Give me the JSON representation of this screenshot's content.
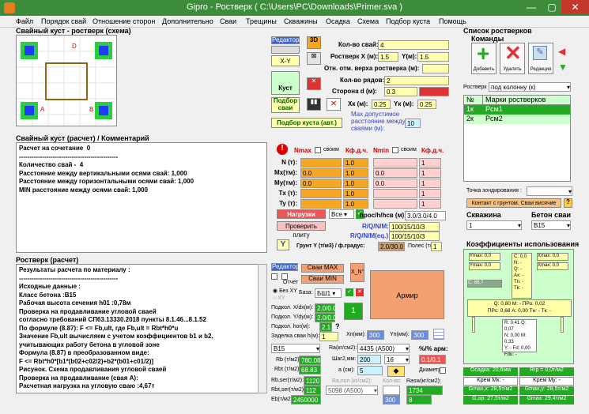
{
  "window": {
    "title": "Gipro - Ростверк ( C:\\Users\\PC\\Downloads\\Primer.sva )",
    "minimize": "—",
    "maximize": "▢",
    "close": "✕"
  },
  "menu": [
    "Файл",
    "Порядок свай",
    "Отношение сторон",
    "Дополнительно",
    "Сваи",
    "Трещины",
    "Скважины",
    "Осадка",
    "Схема",
    "Подбор куста",
    "Помощь"
  ],
  "scheme": {
    "title": "Свайный куст - ростверк (схема)",
    "pile_labels": [
      "D",
      "A",
      "B"
    ]
  },
  "tools": {
    "editor": "Редактор",
    "btn3d": "3D",
    "xy": "X-Y",
    "kust": "Куст",
    "podbor": "Подбор сваи",
    "podbor_auto": "Подбор куста (авт.)",
    "kol_svai_label": "Кол-во свай:",
    "kol_svai": "4",
    "rostverk_x_label": "Ростверк X (м):",
    "rostverk_x": "1.5",
    "ym_label": "Y(м):",
    "ym": "1.5",
    "otm_label": "Отн. отм. верха ростверка (м):",
    "otm": "",
    "kol_ryadov_label": "Кол-во рядов:",
    "kol_ryadov": "2",
    "storona_label": "Сторона d (м):",
    "storona": "0.3",
    "storona_extra": "",
    "xk_label": "Xк (м):",
    "xk": "0.25",
    "yk_label": "Yк (м):",
    "yk": "0.25",
    "max_dist_label": "Max допустимое расстояние между сваями (м):",
    "max_dist": "10"
  },
  "comment": {
    "title": "Свайный куст (расчет) / Комментарий",
    "lines": [
      "Расчет на сочетание  0",
      "-----------------------------------------------",
      "Количество свай -  4",
      "Расстояние между вертикальными осями свай: 1,000",
      "Расстояние между горизонтальными осями свай: 1,000",
      "MIN расстояние между осями свай: 1,000"
    ]
  },
  "loads": {
    "nmax": "Nmax",
    "svoim1": "своим",
    "kfdch1": "Кф.д.ч.",
    "nmin": "Nmin",
    "svoim2": "своим",
    "kfdch2": "Кф.д.ч.",
    "rows": [
      {
        "label": "N (т):",
        "v1": "",
        "k1": "1.0",
        "v2": "",
        "k2": "1"
      },
      {
        "label": "Mx(тм):",
        "v1": "0.0",
        "k1": "1.0",
        "v2": "0.0",
        "k2": "1"
      },
      {
        "label": "My(тм):",
        "v1": "0.0",
        "k1": "1.0",
        "v2": "0.0",
        "k2": "1"
      },
      {
        "label": "Tx (т):",
        "v1": "",
        "k1": "1.0",
        "v2": "",
        "k2": "1"
      },
      {
        "label": "Ty (т):",
        "v1": "",
        "k1": "1.0",
        "v2": "",
        "k2": "1"
      }
    ],
    "nagruzki": "Нагрузки",
    "vse": "Все",
    "proverit": "Проверить плиту",
    "hpoc_label": "hpoc/h/hcв (м):",
    "hpoc": "3.0/3.0/4.0",
    "rqnm_label": "R/Q/N/M:",
    "rqnm": "100/15/10/3",
    "rqnmeq_label": "R/Q/N/M(eq.):",
    "rqnmeq": "100/15/10/3",
    "ybtn": "Y",
    "grunt_label": "Грунт Y (т/м3) / ф.градус:",
    "grunt": "2.0/30.0",
    "poles_label": "Полес (т/м3):",
    "poles": "1"
  },
  "result": {
    "title": "Ростверк (расчет)",
    "lines": [
      "Результаты расчета по материалу :",
      "-----------------------------------------------",
      "Исходные данные :",
      "Класс бетона :В15",
      "Рабочая высота сечения h01 :0,78м",
      "Проверка на продавливание угловой сваей",
      "согласно требований СП63.13330.2018 пункты 8.1.46...8.1.52",
      "По формуле (8.87): F <= Fb,ult, где Fb,ult = Rbt*h0*u",
      "Значение Fb,ult вычисляем с учетом коэффициентов b1 и b2,",
      "учитывающих работу бетона в угловой зоне",
      "Формула (8.87) в преобразованном виде:",
      "F <= Rbt*h0*[b1*(b02+c02/2)+b2*(b01+c01/2)]",
      "",
      "Рисунок. Схема продавливания угловой сваей",
      "",
      "Проверка на продавливание (свая А):",
      "Расчетная нагрузка на угловую сваю :4,67т"
    ]
  },
  "armir": {
    "editor": "Редактор",
    "otchet": "Отчет",
    "svai_max": "Сваи MAX",
    "svai_min": "Сваи MIN",
    "xn": "X_N°",
    "bez_xy": "Без XY",
    "xy": "XY",
    "baza_label": "База:",
    "baza": "БШ1",
    "armir": "Армир",
    "one": "1",
    "podkol_x_label": "Подкол. X/dx(м):",
    "podkol_x": "2.0/0.0",
    "podkol_y_label": "Подкол. Y/dy(м):",
    "podkol_y": "2.0/0.0",
    "podkol_hor_label": "Подкол. hor(м):",
    "podkol_hor": "2.1",
    "zadelka_label": "Заделка сваи h(м):",
    "zadelka": "1",
    "xn_label": "Xn(мм):",
    "xn_val": "300",
    "yn_label": "Yn(мм):",
    "yn_val": "300",
    "beton": "B15",
    "rb_label": "Rb (т/м2):",
    "rb": "780.08",
    "rbt_label": "Rbt (т/м2):",
    "rbt": "68.83",
    "ra_label": "Ra(кг/см2):",
    "ra": "4435 (A500)",
    "shag_label": "Шаг2,мм:",
    "shag": "200",
    "d": "16",
    "a_label": "a (см):",
    "a": "5",
    "pct_label": "%/% арм:",
    "pct": "0.1/0.1",
    "diam": "Диаметр",
    "rbser_label": "Rb,ser(т/м2):",
    "rbser": "1120",
    "rbtser_label": "Rbt,ser(т/м2):",
    "rbtser": "112",
    "eb_label": "Eb(т/м2):",
    "eb": "2450000",
    "rapoper_label": "Ra,поп (кг/см2):",
    "rapoper": "5098 (A500)",
    "kolvo_label": "Кол-во:",
    "rasw_label": "Rasw(кг/см2):",
    "rasw": "1734 (A240)",
    "rasw_n": "300",
    "rasw_m": "8"
  },
  "right": {
    "title": "Список ростверков",
    "komandy": "Команды",
    "add": "Добавить",
    "del": "Удалить",
    "edit": "Редакция",
    "rostverk_label": "Ростверк",
    "rostverk": "под колонну (к)",
    "table_head": [
      "№",
      "Марки ростверков"
    ],
    "rows": [
      [
        "1к",
        "Рсм1"
      ],
      [
        "2к",
        "Рсм2"
      ]
    ],
    "tochka_label": "Точка зондирования :",
    "kontakt": "Контакт с грунтом. Сваи висячие",
    "q": "?",
    "skvazhina_label": "Скважина",
    "skvazhina": "1",
    "beton_label": "Бетон сваи",
    "beton": "B15",
    "koef_title": "Коэффициенты использования",
    "k": {
      "ymax1": "Ymax: 0,0",
      "ymax2": "Ymax: 0,0",
      "xmax1": "Xmax: 0,0",
      "xmax2": "Xmax: 0,0",
      "c1": "C: 0,0",
      "n": "N: -",
      "q": "Q: -",
      "ax": "Ax: -",
      "tn": "Tn: -",
      "tk": "Tk: -",
      "c2": "C: 88,7",
      "qmr": "Q: 0,80  М: - ПРо: 0,02",
      "prc": "ПРс: 0,68  А: 0,00 Тн: - Тк: -",
      "r": "R: 0,41 Q: 0,07",
      "n2": "N: 0,00 M: 0,33",
      "y": "Y: - Fd: 0,00",
      "fdu": "Fdu: -"
    },
    "bottom": [
      [
        "Осадка: 20,6мм",
        "Rrp = 0,0т/м2"
      ],
      [
        "Kрем Mx: -",
        "Kрем My: -"
      ],
      [
        "Gmax,x: 28,5т/м2",
        "Gmax,y: 28,5т/м2"
      ],
      [
        "G,ор: 27,5т/м2",
        "Gmax: 29,4т/м2"
      ]
    ]
  }
}
